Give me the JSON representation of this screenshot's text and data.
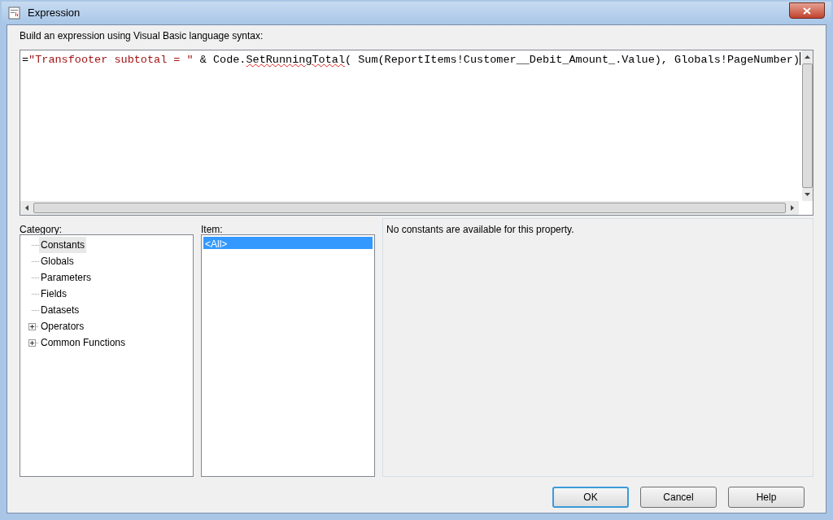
{
  "window": {
    "title": "Expression"
  },
  "prompt": "Build an expression using Visual Basic language syntax:",
  "expression": {
    "segments": [
      {
        "kind": "plain",
        "text": "=",
        "misspelled": false
      },
      {
        "kind": "string",
        "text": "\"Transfooter subtotal = \"",
        "misspelled": false
      },
      {
        "kind": "plain",
        "text": " & Code.",
        "misspelled": false
      },
      {
        "kind": "plain",
        "text": "SetRunningTotal",
        "misspelled": true
      },
      {
        "kind": "plain",
        "text": "( Sum(ReportItems!Customer__Debit_Amount_.Value), Globals!PageNumber)",
        "misspelled": false
      }
    ]
  },
  "category": {
    "label": "Category:",
    "items": [
      {
        "label": "Constants",
        "kind": "leaf",
        "selected": true
      },
      {
        "label": "Globals",
        "kind": "leaf",
        "selected": false
      },
      {
        "label": "Parameters",
        "kind": "leaf",
        "selected": false
      },
      {
        "label": "Fields",
        "kind": "leaf",
        "selected": false
      },
      {
        "label": "Datasets",
        "kind": "leaf",
        "selected": false
      },
      {
        "label": "Operators",
        "kind": "expandable",
        "selected": false,
        "expanded": false
      },
      {
        "label": "Common Functions",
        "kind": "expandable",
        "selected": false,
        "expanded": false
      }
    ]
  },
  "item": {
    "label": "Item:",
    "items": [
      {
        "label": "<All>",
        "selected": true
      }
    ]
  },
  "description": "No constants are available for this property.",
  "buttons": [
    {
      "label": "OK",
      "default": true
    },
    {
      "label": "Cancel",
      "default": false
    },
    {
      "label": "Help",
      "default": false
    }
  ]
}
